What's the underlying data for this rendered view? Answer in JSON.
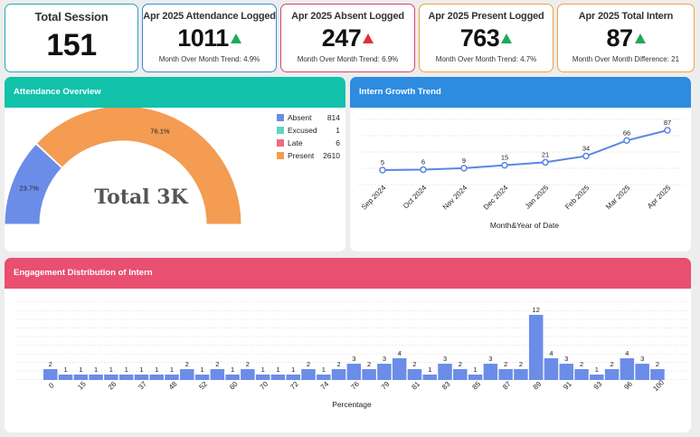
{
  "kpis": {
    "total_session": {
      "title": "Total Session",
      "value": "151",
      "color": "#22a8b8"
    },
    "attendance": {
      "title": "Apr 2025 Attendance Logged",
      "value": "1011",
      "trend": "up",
      "sub": "Month Over Month Trend: 4.9%",
      "color": "#3b8ad8"
    },
    "absent": {
      "title": "Apr 2025 Absent Logged",
      "value": "247",
      "trend": "up-red",
      "sub": "Month Over Month Trend: 6.9%",
      "color": "#d6456a"
    },
    "present": {
      "title": "Apr 2025 Present Logged",
      "value": "763",
      "trend": "up",
      "sub": "Month Over Month Trend: 4.7%",
      "color": "#f0a040"
    },
    "intern": {
      "title": "Apr 2025 Total Intern",
      "value": "87",
      "trend": "up",
      "sub": "Month Over Month Difference: 21",
      "color": "#f0a040"
    }
  },
  "attendance_overview": {
    "title": "Attendance Overview",
    "header_color": "#12c2aa",
    "center_label": "Total 3K"
  },
  "intern_growth": {
    "title": "Intern Growth Trend",
    "header_color": "#2d8be0"
  },
  "engagement": {
    "title": "Engagement Distribution of Intern",
    "header_color": "#e84f70"
  },
  "chart_data": [
    {
      "type": "pie",
      "variant": "semi-donut",
      "categories": [
        "Absent",
        "Excused",
        "Late",
        "Present"
      ],
      "values": [
        814,
        1,
        6,
        2610
      ],
      "colors": [
        "#6b8de8",
        "#5fd6c0",
        "#ef6b7f",
        "#f39c52"
      ],
      "slice_labels": [
        "23.7%",
        "",
        "",
        "76.1%"
      ],
      "center_label": "Total 3K",
      "legend": "top-right"
    },
    {
      "type": "line",
      "categories": [
        "Sep 2024",
        "Oct 2024",
        "Nov 2024",
        "Dec 2024",
        "Jan 2025",
        "Feb 2025",
        "Mar 2025",
        "Apr 2025"
      ],
      "values": [
        5,
        6,
        9,
        15,
        21,
        34,
        66,
        87
      ],
      "xlabel": "Month&Year of Date",
      "ylabel": "",
      "color": "#5b86e5",
      "grid": true
    },
    {
      "type": "bar",
      "categories": [
        "0",
        "",
        "15",
        "",
        "26",
        "",
        "37",
        "",
        "48",
        "",
        "52",
        "",
        "60",
        "",
        "70",
        "",
        "72",
        "",
        "74",
        "",
        "76",
        "",
        "79",
        "",
        "81",
        "",
        "83",
        "",
        "85",
        "",
        "87",
        "",
        "89",
        "",
        "91",
        "",
        "93",
        "",
        "96",
        "",
        "100"
      ],
      "values": [
        2,
        1,
        1,
        1,
        1,
        1,
        1,
        1,
        1,
        2,
        1,
        2,
        1,
        2,
        1,
        1,
        1,
        2,
        1,
        2,
        3,
        2,
        3,
        4,
        2,
        1,
        3,
        2,
        1,
        3,
        2,
        2,
        12,
        4,
        3,
        2,
        1,
        2,
        4,
        3,
        2
      ],
      "xlabel": "Percentage",
      "ylabel": "",
      "color": "#6b8de8",
      "grid": true
    }
  ]
}
